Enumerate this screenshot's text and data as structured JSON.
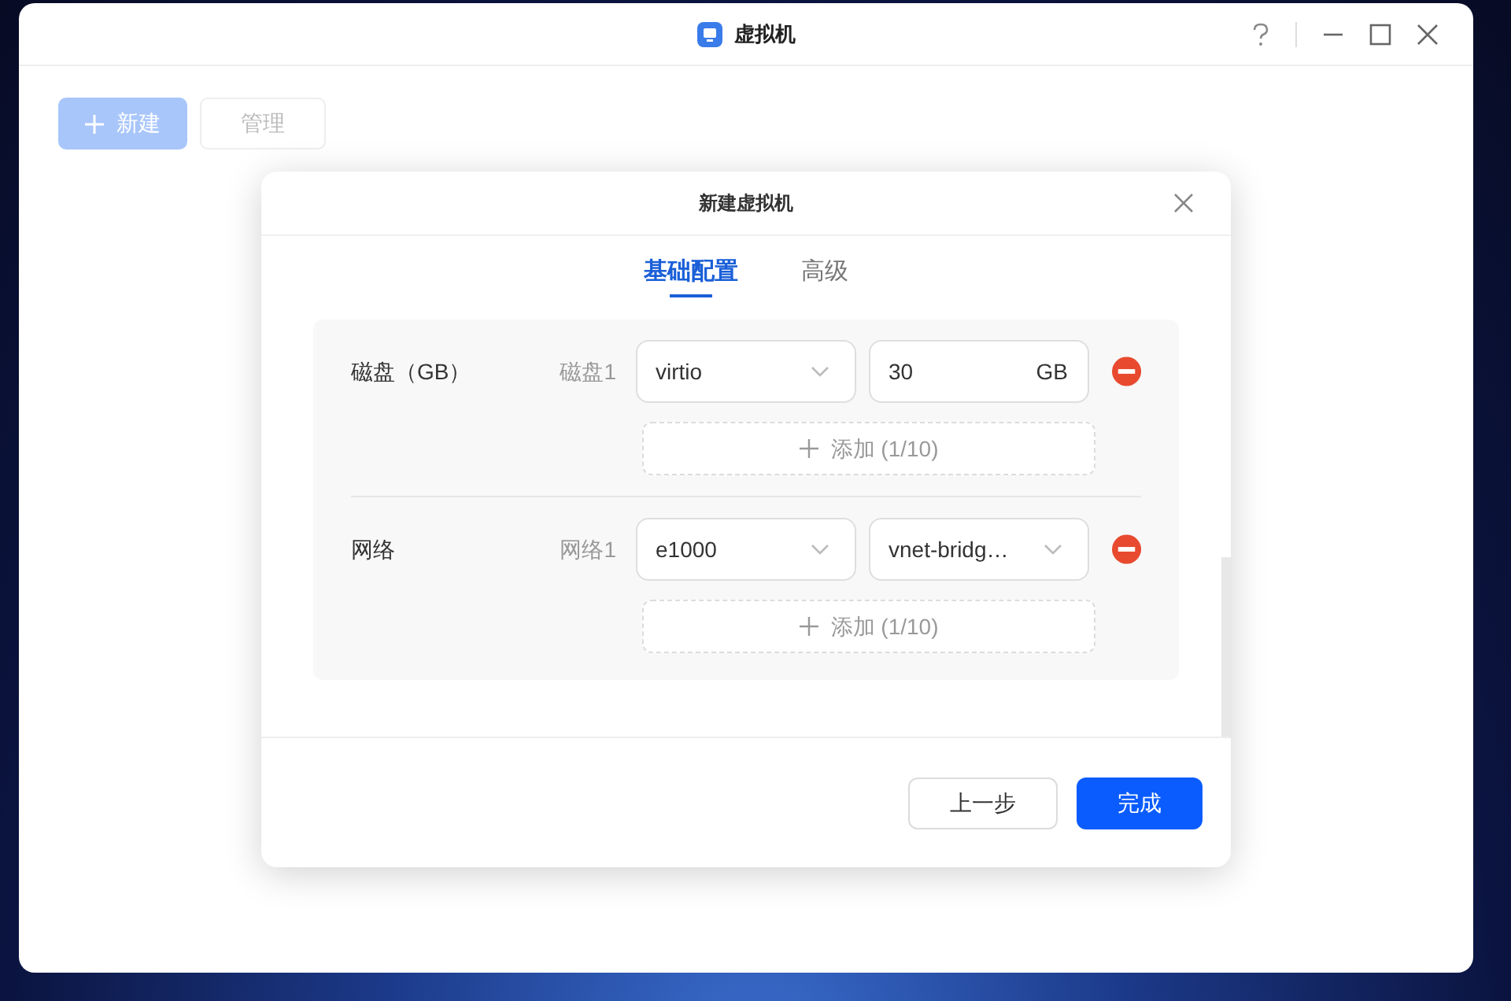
{
  "window": {
    "title": "虚拟机"
  },
  "toolbar": [
    {
      "label": "新建",
      "kind": "primary",
      "disabled": true
    },
    {
      "label": "管理",
      "kind": "default",
      "disabled": true
    }
  ],
  "dialog": {
    "title": "新建虚拟机",
    "tabs": [
      {
        "label": "基础配置",
        "selected": true
      },
      {
        "label": "高级",
        "selected": false
      }
    ],
    "sections": [
      {
        "label": "磁盘（GB）",
        "items": [
          {
            "label": "磁盘1",
            "fields": [
              {
                "kind": "select",
                "value": "virtio"
              },
              {
                "kind": "input",
                "value": "30",
                "suffix": "GB"
              }
            ]
          }
        ],
        "add_button": "添加 (1/10)"
      },
      {
        "label": "网络",
        "items": [
          {
            "label": "网络1",
            "fields": [
              {
                "kind": "select",
                "value": "e1000"
              },
              {
                "kind": "select",
                "value": "vnet-bridg…"
              }
            ]
          }
        ],
        "add_button": "添加 (1/10)"
      }
    ],
    "buttons": [
      {
        "label": "上一步",
        "kind": "default"
      },
      {
        "label": "完成",
        "kind": "primary"
      }
    ]
  }
}
